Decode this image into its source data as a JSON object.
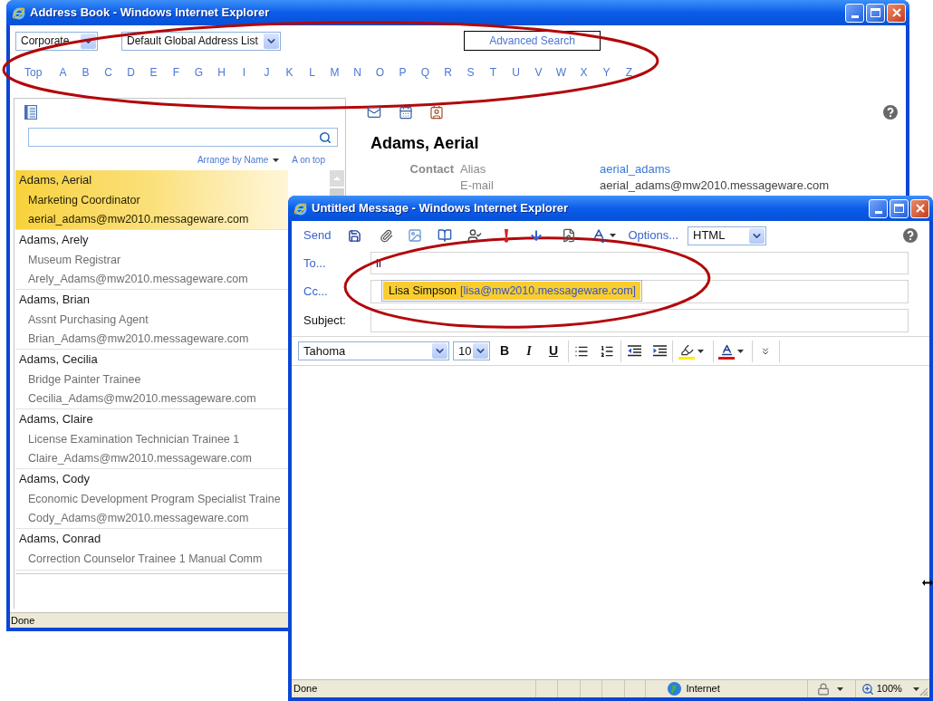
{
  "address_book": {
    "window": {
      "title": "Address Book - Windows Internet Explorer"
    },
    "directory": "Corporate",
    "address_list": "Default Global Address List",
    "advanced_search": "Advanced Search",
    "alphabet": {
      "top": "Top",
      "letters": [
        "A",
        "B",
        "C",
        "D",
        "E",
        "F",
        "G",
        "H",
        "I",
        "J",
        "K",
        "L",
        "M",
        "N",
        "O",
        "P",
        "Q",
        "R",
        "S",
        "T",
        "U",
        "V",
        "W",
        "X",
        "Y",
        "Z"
      ]
    },
    "sort": {
      "arrange_by": "Arrange by Name",
      "order": "A on top"
    },
    "contacts": [
      {
        "name": "Adams, Aerial",
        "title": "Marketing Coordinator",
        "email": "aerial_adams@mw2010.messageware.com",
        "selected": true
      },
      {
        "name": "Adams, Arely",
        "title": "Museum Registrar",
        "email": "Arely_Adams@mw2010.messageware.com",
        "selected": false
      },
      {
        "name": "Adams, Brian",
        "title": "Assnt Purchasing Agent",
        "email": "Brian_Adams@mw2010.messageware.com",
        "selected": false
      },
      {
        "name": "Adams, Cecilia",
        "title": "Bridge Painter Trainee",
        "email": "Cecilia_Adams@mw2010.messageware.com",
        "selected": false
      },
      {
        "name": "Adams, Claire",
        "title": "License Examination Technician Trainee 1",
        "email": "Claire_Adams@mw2010.messageware.com",
        "selected": false
      },
      {
        "name": "Adams, Cody",
        "title": "Economic Development Program Specialist Traine",
        "email": "Cody_Adams@mw2010.messageware.com",
        "selected": false
      },
      {
        "name": "Adams, Conrad",
        "title": "Correction Counselor Trainee 1 Manual Comm",
        "selected": false
      }
    ],
    "detail": {
      "name": "Adams, Aerial",
      "section": "Contact",
      "fields": [
        {
          "label": "Alias",
          "value": "aerial_adams",
          "kind": "link"
        },
        {
          "label": "E-mail",
          "value": "aerial_adams@mw2010.messageware.com",
          "kind": "text"
        }
      ]
    },
    "status_bar": {
      "text": "Done"
    }
  },
  "message": {
    "window": {
      "title": "Untitled Message - Windows Internet Explorer"
    },
    "toolbar": {
      "send": "Send",
      "options": "Options...",
      "format": "HTML"
    },
    "fields": [
      {
        "kind": "link",
        "label": "To...",
        "value": "li"
      },
      {
        "kind": "link",
        "label": "Cc..."
      },
      {
        "kind": "plain",
        "label": "Subject:"
      }
    ],
    "suggestion": {
      "name": "Lisa Simpson",
      "address": "[lisa@mw2010.messageware.com]"
    },
    "format_bar": {
      "font": "Tahoma",
      "size": "10",
      "buttons": [
        {
          "label": "B",
          "kind": "bold"
        },
        {
          "label": "I",
          "kind": "italic"
        },
        {
          "label": "U",
          "kind": "underline"
        }
      ]
    },
    "status_bar": {
      "text": "Done",
      "zone": "Internet",
      "zoom": "100%"
    }
  }
}
